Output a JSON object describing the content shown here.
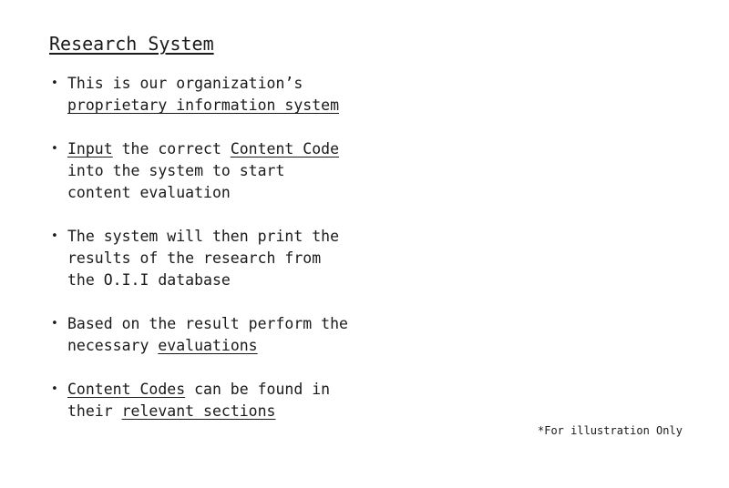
{
  "title": "Research System",
  "bullets": [
    {
      "text_1": "This is our organization’s ",
      "link_1": "proprietary information system"
    },
    {
      "link_1": "Input",
      "text_1": " the correct ",
      "link_2": "Content Code",
      "text_2": " into the system to start content evaluation"
    },
    {
      "text_1": "The system will then print the results of the research from the O.I.I database"
    },
    {
      "text_1": "Based on the result perform the necessary ",
      "link_1": "evaluations"
    },
    {
      "link_1": "Content Codes",
      "text_1": " can be found in their ",
      "link_2": "relevant sections"
    }
  ],
  "footnote": "*For illustration Only"
}
